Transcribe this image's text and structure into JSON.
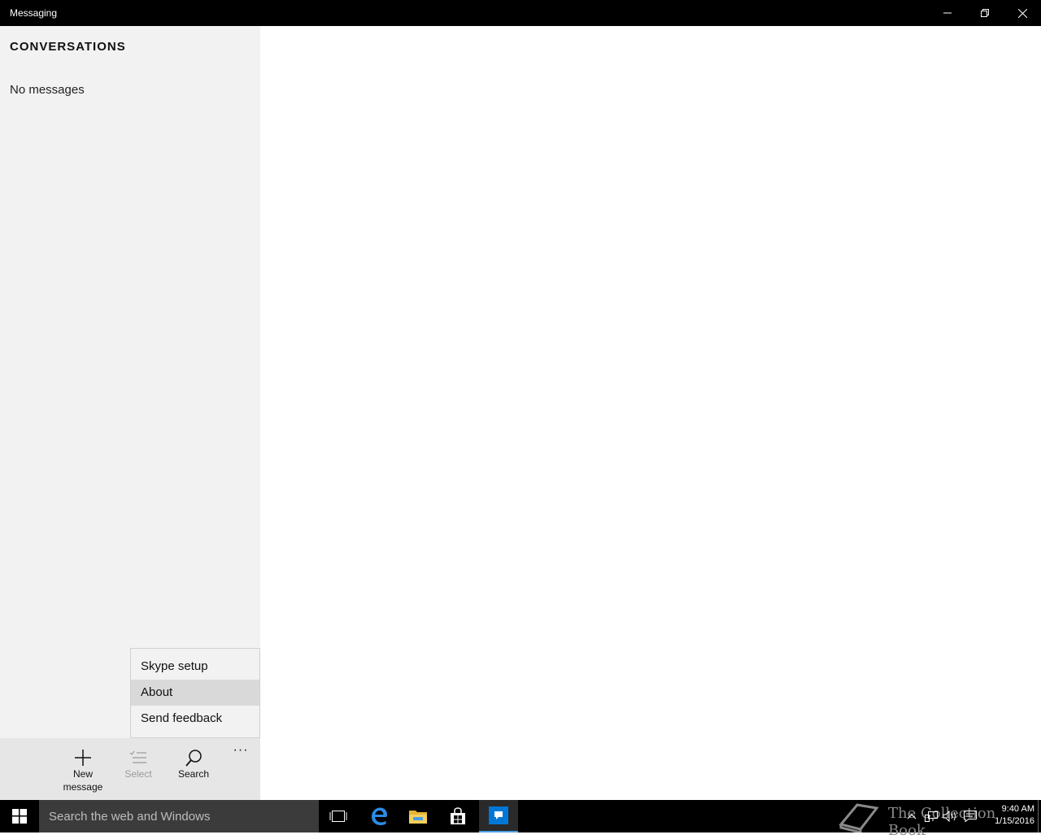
{
  "window": {
    "title": "Messaging",
    "controls": [
      "minimize-icon",
      "restore-icon",
      "close-icon"
    ]
  },
  "sidebar": {
    "heading": "CONVERSATIONS",
    "empty_text": "No messages"
  },
  "overflow_menu": {
    "items": [
      {
        "label": "Skype setup"
      },
      {
        "label": "About",
        "highlighted": true
      },
      {
        "label": "Send feedback"
      }
    ]
  },
  "command_bar": {
    "new_message": {
      "label": "New message",
      "icon": "plus-icon"
    },
    "select": {
      "label": "Select",
      "icon": "select-list-icon",
      "enabled": false
    },
    "search": {
      "label": "Search",
      "icon": "search-icon"
    },
    "more": {
      "label": "···",
      "icon": "more-icon"
    }
  },
  "taskbar": {
    "search_placeholder": "Search the web and Windows",
    "apps": [
      "task-view-icon",
      "edge-icon",
      "file-explorer-icon",
      "store-icon",
      "messaging-icon"
    ],
    "watermark": "The Collection Book",
    "clock": {
      "time": "9:40 AM",
      "date": "1/15/2016"
    }
  },
  "colors": {
    "titlebar": "#000000",
    "sidebar": "#f2f2f2",
    "command_bar": "#e6e6e6",
    "accent": "#0078d7"
  }
}
